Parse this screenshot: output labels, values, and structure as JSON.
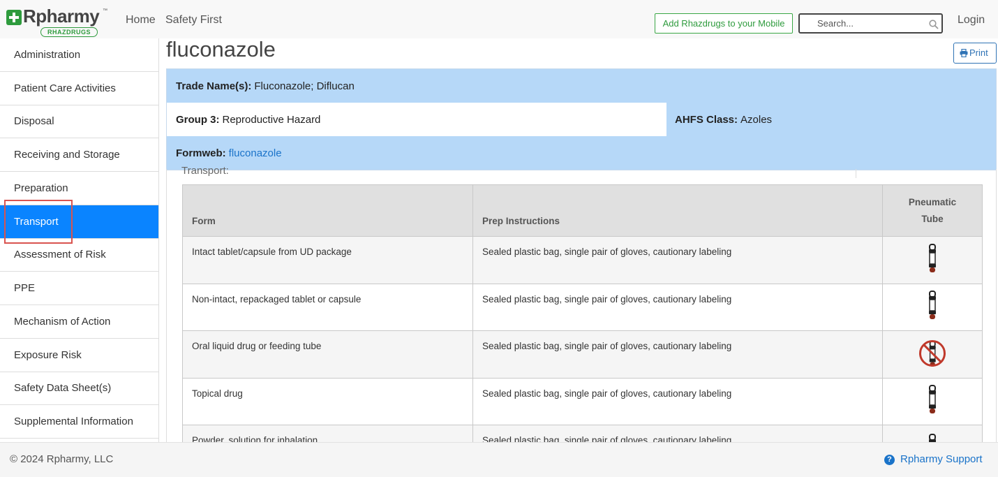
{
  "header": {
    "logo_text": "Rpharmy",
    "logo_tm": "™",
    "logo_sub": "RHAZDRUGS",
    "nav": [
      "Home",
      "Safety First"
    ],
    "mobile_button": "Add Rhazdrugs to your Mobile",
    "search_placeholder": "Search...",
    "login": "Login"
  },
  "sidebar": {
    "items": [
      {
        "label": "Administration"
      },
      {
        "label": "Patient Care Activities"
      },
      {
        "label": "Disposal"
      },
      {
        "label": "Receiving and Storage"
      },
      {
        "label": "Preparation"
      },
      {
        "label": "Transport"
      },
      {
        "label": "Assessment of Risk"
      },
      {
        "label": "PPE"
      },
      {
        "label": "Mechanism of Action"
      },
      {
        "label": "Exposure Risk"
      },
      {
        "label": "Safety Data Sheet(s)"
      },
      {
        "label": "Supplemental Information"
      }
    ],
    "active": "Transport"
  },
  "main": {
    "title": "fluconazole",
    "print_label": "Print",
    "trade_label": "Trade Name(s):",
    "trade_value": "Fluconazole; Diflucan",
    "group_label": "Group 3:",
    "group_value": "Reproductive Hazard",
    "ahfs_label": "AHFS Class:",
    "ahfs_value": "Azoles",
    "formweb_label": "Formweb:",
    "formweb_link": "fluconazole",
    "section_label": "Transport:",
    "table": {
      "headers": {
        "form": "Form",
        "prep": "Prep Instructions",
        "tube_line1": "Pneumatic",
        "tube_line2": "Tube"
      },
      "rows": [
        {
          "form": "Intact tablet/capsule from UD package",
          "prep": "Sealed plastic bag, single pair of gloves, cautionary labeling",
          "tube": "pneumatic-tube-allowed"
        },
        {
          "form": "Non-intact, repackaged tablet or capsule",
          "prep": "Sealed plastic bag, single pair of gloves, cautionary labeling",
          "tube": "pneumatic-tube-allowed"
        },
        {
          "form": "Oral liquid drug or feeding tube",
          "prep": "Sealed plastic bag, single pair of gloves, cautionary labeling",
          "tube": "pneumatic-tube-prohibited"
        },
        {
          "form": "Topical drug",
          "prep": "Sealed plastic bag, single pair of gloves, cautionary labeling",
          "tube": "pneumatic-tube-allowed"
        },
        {
          "form": "Powder, solution for inhalation",
          "prep": "Sealed plastic bag, single pair of gloves, cautionary labeling",
          "tube": "pneumatic-tube-allowed"
        }
      ]
    }
  },
  "footer": {
    "copyright": "© 2024 Rpharmy, LLC",
    "support": "Rpharmy Support"
  },
  "colors": {
    "brand_green": "#2e9b3d",
    "active_blue": "#0a84ff",
    "info_blue": "#b6d8f8",
    "link_blue": "#1a73c9",
    "highlight_red": "#d9534f"
  }
}
